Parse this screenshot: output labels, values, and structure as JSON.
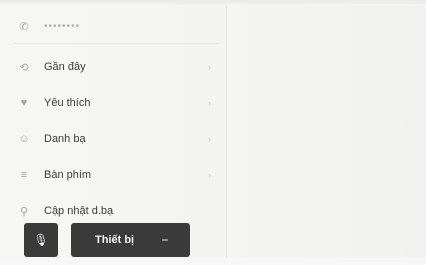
{
  "phone": {
    "number": "••••••••",
    "icon": "phone-icon"
  },
  "menu": [
    {
      "label": "Gần đây",
      "icon": "recent-icon",
      "symbol": "⟲"
    },
    {
      "label": "Yêu thích",
      "icon": "favorite-icon",
      "symbol": "♥"
    },
    {
      "label": "Danh bạ",
      "icon": "contacts-icon",
      "symbol": "☺"
    },
    {
      "label": "Bàn phím",
      "icon": "keypad-icon",
      "symbol": "≡"
    },
    {
      "label": "Cập nhật d.bạ",
      "icon": "contacts-update-icon",
      "symbol": "⚲"
    }
  ],
  "bottom": {
    "mic_icon": "microphone-icon",
    "device_label": "Thiết bị"
  },
  "colors": {
    "button_bg": "#3a3a3a",
    "background": "#f5f5f3"
  }
}
